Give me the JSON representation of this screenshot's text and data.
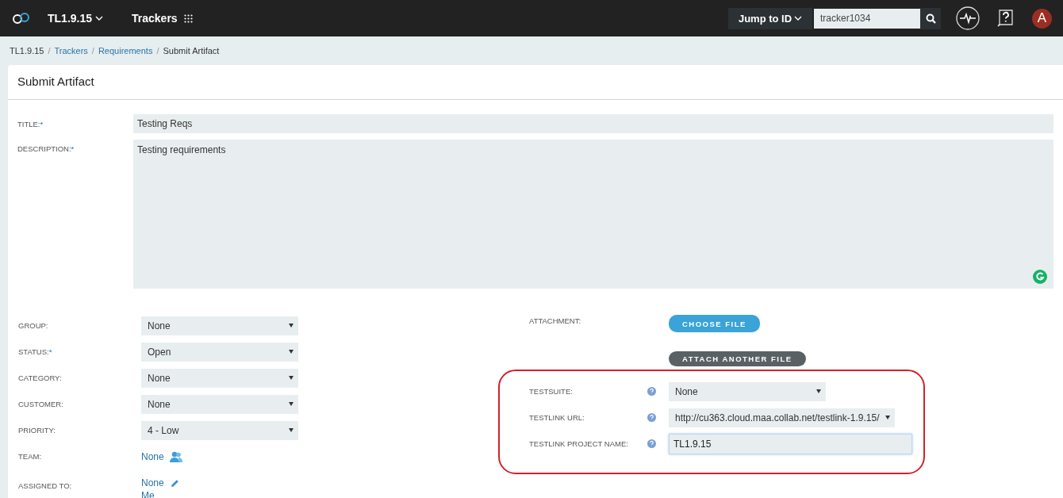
{
  "header": {
    "project": "TL1.9.15",
    "nav_item": "Trackers",
    "jump_button": "Jump to ID",
    "jump_value": "tracker1034",
    "avatar_letter": "A"
  },
  "breadcrumb_separator": "/",
  "breadcrumb": [
    {
      "label": "TL1.9.15",
      "link": false
    },
    {
      "label": "Trackers",
      "link": true
    },
    {
      "label": "Requirements",
      "link": true
    },
    {
      "label": "Submit Artifact",
      "link": false
    }
  ],
  "page_title": "Submit Artifact",
  "title_field": {
    "label": "TITLE:",
    "required_mark": "*",
    "value": "Testing Reqs"
  },
  "description_field": {
    "label": "DESCRIPTION:",
    "required_mark": "*",
    "value": "Testing requirements"
  },
  "left_fields": [
    {
      "kind": "select",
      "label": "GROUP:",
      "value": "None"
    },
    {
      "kind": "select",
      "label": "STATUS:",
      "required_mark": "*",
      "value": "Open"
    },
    {
      "kind": "select",
      "label": "CATEGORY:",
      "value": "None"
    },
    {
      "kind": "select",
      "label": "CUSTOMER:",
      "value": "None"
    },
    {
      "kind": "select",
      "label": "PRIORITY:",
      "value": "4 - Low"
    },
    {
      "kind": "team",
      "label": "TEAM:",
      "value": "None"
    },
    {
      "kind": "assignee",
      "label": "ASSIGNED TO:",
      "value": "None",
      "extra_link": "Me"
    }
  ],
  "attachment": {
    "label": "ATTACHMENT:",
    "choose_button": "CHOOSE FILE",
    "attach_button": "ATTACH ANOTHER FILE"
  },
  "testlink_section": {
    "highlighted": true,
    "fields": [
      {
        "kind": "select",
        "label": "TESTSUITE:",
        "value": "None"
      },
      {
        "kind": "wide_select",
        "label": "TESTLINK URL:",
        "value": "http://cu363.cloud.maa.collab.net/testlink-1.9.15/"
      },
      {
        "kind": "text",
        "label": "TESTLINK PROJECT NAME:",
        "value": "TL1.9.15",
        "focused": true
      }
    ]
  }
}
